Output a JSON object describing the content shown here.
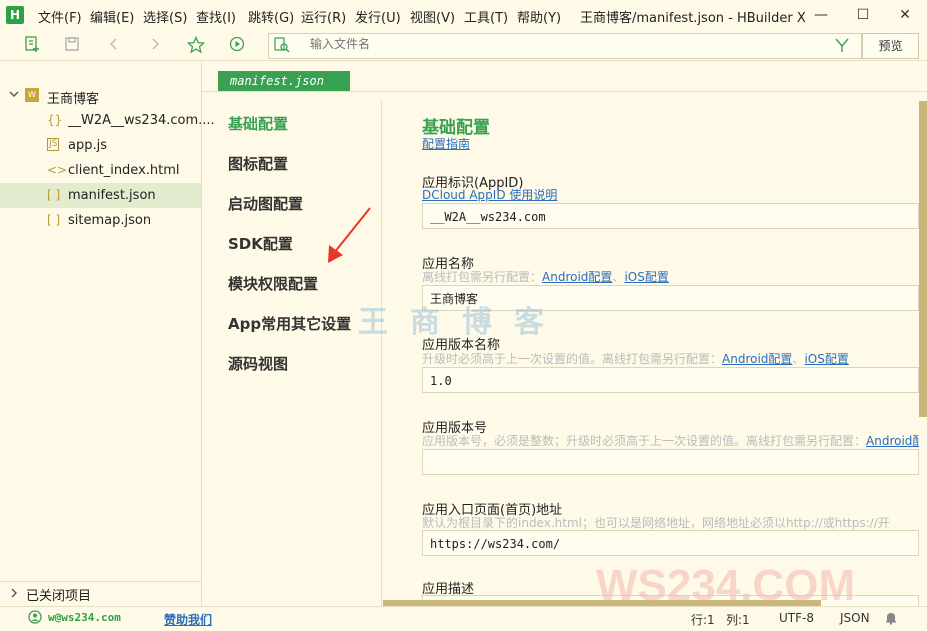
{
  "app": {
    "logo": "H",
    "title": "王商博客/manifest.json - HBuilder X"
  },
  "menu": [
    "文件(F)",
    "编辑(E)",
    "选择(S)",
    "查找(I)",
    "跳转(G)",
    "运行(R)",
    "发行(U)",
    "视图(V)",
    "工具(T)",
    "帮助(Y)"
  ],
  "window_controls": {
    "minimize": "—",
    "maximize": "☐",
    "close": "✕"
  },
  "toolbar": {
    "search_placeholder": "输入文件名",
    "preview": "预览"
  },
  "sidebar": {
    "project": "王商博客",
    "files": [
      {
        "icon": "{}",
        "name": "__W2A__ws234.com...."
      },
      {
        "icon": "JS",
        "name": "app.js"
      },
      {
        "icon": "<>",
        "name": "client_index.html"
      },
      {
        "icon": "[ ]",
        "name": "manifest.json"
      },
      {
        "icon": "[ ]",
        "name": "sitemap.json"
      }
    ],
    "closed_projects": "已关闭项目"
  },
  "tab": {
    "label": "manifest.json"
  },
  "nav": [
    "基础配置",
    "图标配置",
    "启动图配置",
    "SDK配置",
    "模块权限配置",
    "App常用其它设置",
    "源码视图"
  ],
  "form": {
    "title": "基础配置",
    "guide_link": "配置指南",
    "appid": {
      "label": "应用标识(AppID)",
      "link": "DCloud AppID 使用说明",
      "value": "__W2A__ws234.com"
    },
    "name": {
      "label": "应用名称",
      "hint": "离线打包需另行配置：",
      "link1": "Android配置",
      "sep": "、",
      "link2": "iOS配置",
      "value": "王商博客"
    },
    "version_name": {
      "label": "应用版本名称",
      "hint": "升级时必须高于上一次设置的值。离线打包需另行配置：",
      "link1": "Android配置",
      "sep": "、",
      "link2": "iOS配置",
      "value": "1.0"
    },
    "version_code": {
      "label": "应用版本号",
      "hint": "应用版本号，必须是整数；升级时必须高于上一次设置的值。离线打包需另行配置：",
      "link1": "Android配",
      "value": ""
    },
    "entry": {
      "label": "应用入口页面(首页)地址",
      "hint": "默认为根目录下的index.html；也可以是网络地址，网络地址必须以http://或https://开",
      "value": "https://ws234.com/"
    },
    "desc": {
      "label": "应用描述"
    }
  },
  "watermark": {
    "cn": "王商博客",
    "en": "WS234.COM"
  },
  "status": {
    "user": "w@ws234.com",
    "sponsor": "赞助我们",
    "line": "行:1",
    "col": "列:1",
    "encoding": "UTF-8",
    "language": "JSON"
  },
  "colors": {
    "accent": "#38a152",
    "link": "#2a6dbd",
    "background": "#fffae8",
    "scrollbar": "#c9b678"
  }
}
